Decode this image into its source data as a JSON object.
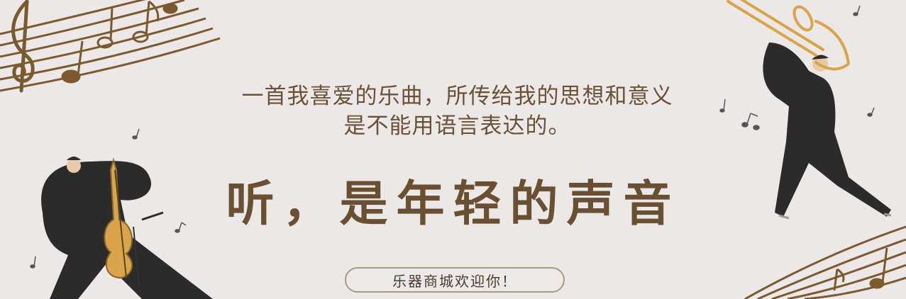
{
  "banner": {
    "quote_line1": "一首我喜爱的乐曲，所传给我的思想和意义",
    "quote_line2": "是不能用语言表达的。",
    "headline": "听，是年轻的声音",
    "welcome_button": "乐器商城欢迎你！"
  },
  "colors": {
    "background": "#ece8e8",
    "text_brown": "#6a5033",
    "staff_brown": "#7a5a2e",
    "suit_black": "#2b2b2b",
    "instrument_gold": "#d9a54a"
  },
  "icons": [
    "treble-clef-icon",
    "music-note-icon",
    "cellist-illustration",
    "trombonist-illustration"
  ]
}
